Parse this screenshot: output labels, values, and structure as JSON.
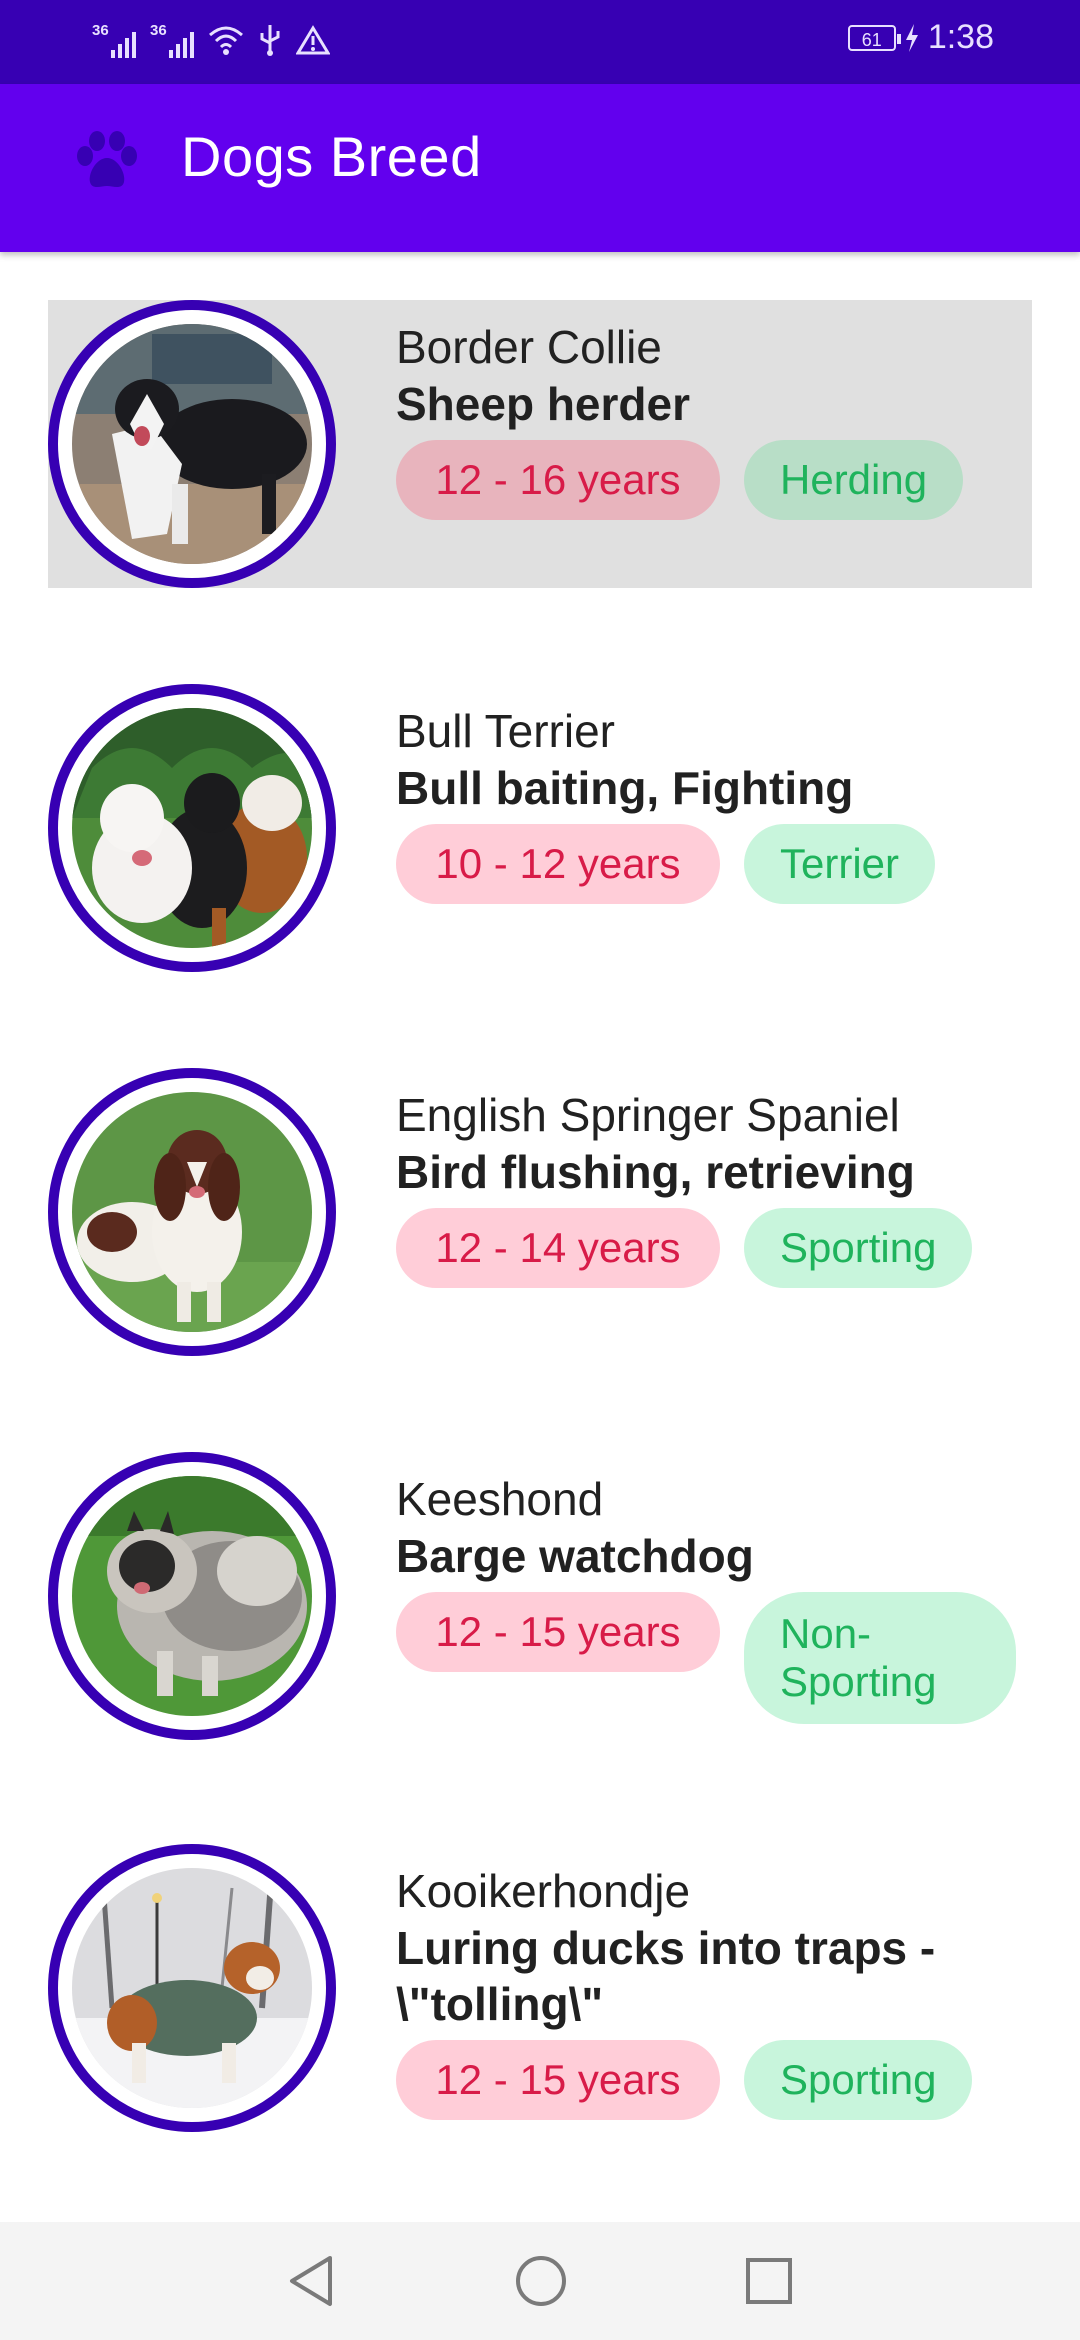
{
  "status_bar": {
    "signal_1_tag": "36",
    "signal_2_tag": "36",
    "battery": "61",
    "time": "1:38"
  },
  "app_bar": {
    "title": "Dogs Breed",
    "icon": "paw-icon"
  },
  "breeds": [
    {
      "name": "Border Collie",
      "bred_for": "Sheep herder",
      "life_span": "12 - 16 years",
      "group": "Herding",
      "selected": true
    },
    {
      "name": "Bull Terrier",
      "bred_for": "Bull baiting, Fighting",
      "life_span": "10 - 12 years",
      "group": "Terrier"
    },
    {
      "name": "English Springer Spaniel",
      "bred_for": "Bird flushing, retrieving",
      "life_span": "12 - 14 years",
      "group": "Sporting"
    },
    {
      "name": "Keeshond",
      "bred_for": "Barge watchdog",
      "life_span": "12 - 15 years",
      "group": "Non-Sporting"
    },
    {
      "name": "Kooikerhondje",
      "bred_for": "Luring ducks into traps - \\\"tolling\\\"",
      "life_span": "12 - 15 years",
      "group": "Sporting"
    }
  ],
  "colors": {
    "status_bar": "#3700b3",
    "app_bar": "#6200ee",
    "avatar_ring": "#3700b3",
    "life_chip_bg": "#ffcdd8",
    "life_chip_text": "#d81b48",
    "group_chip_bg": "#c8f5dc",
    "group_chip_text": "#1fb35c",
    "selected_row": "#e0e0e0"
  },
  "nav_bar": {
    "back": "back-triangle-icon",
    "home": "home-circle-icon",
    "recents": "recents-square-icon"
  }
}
